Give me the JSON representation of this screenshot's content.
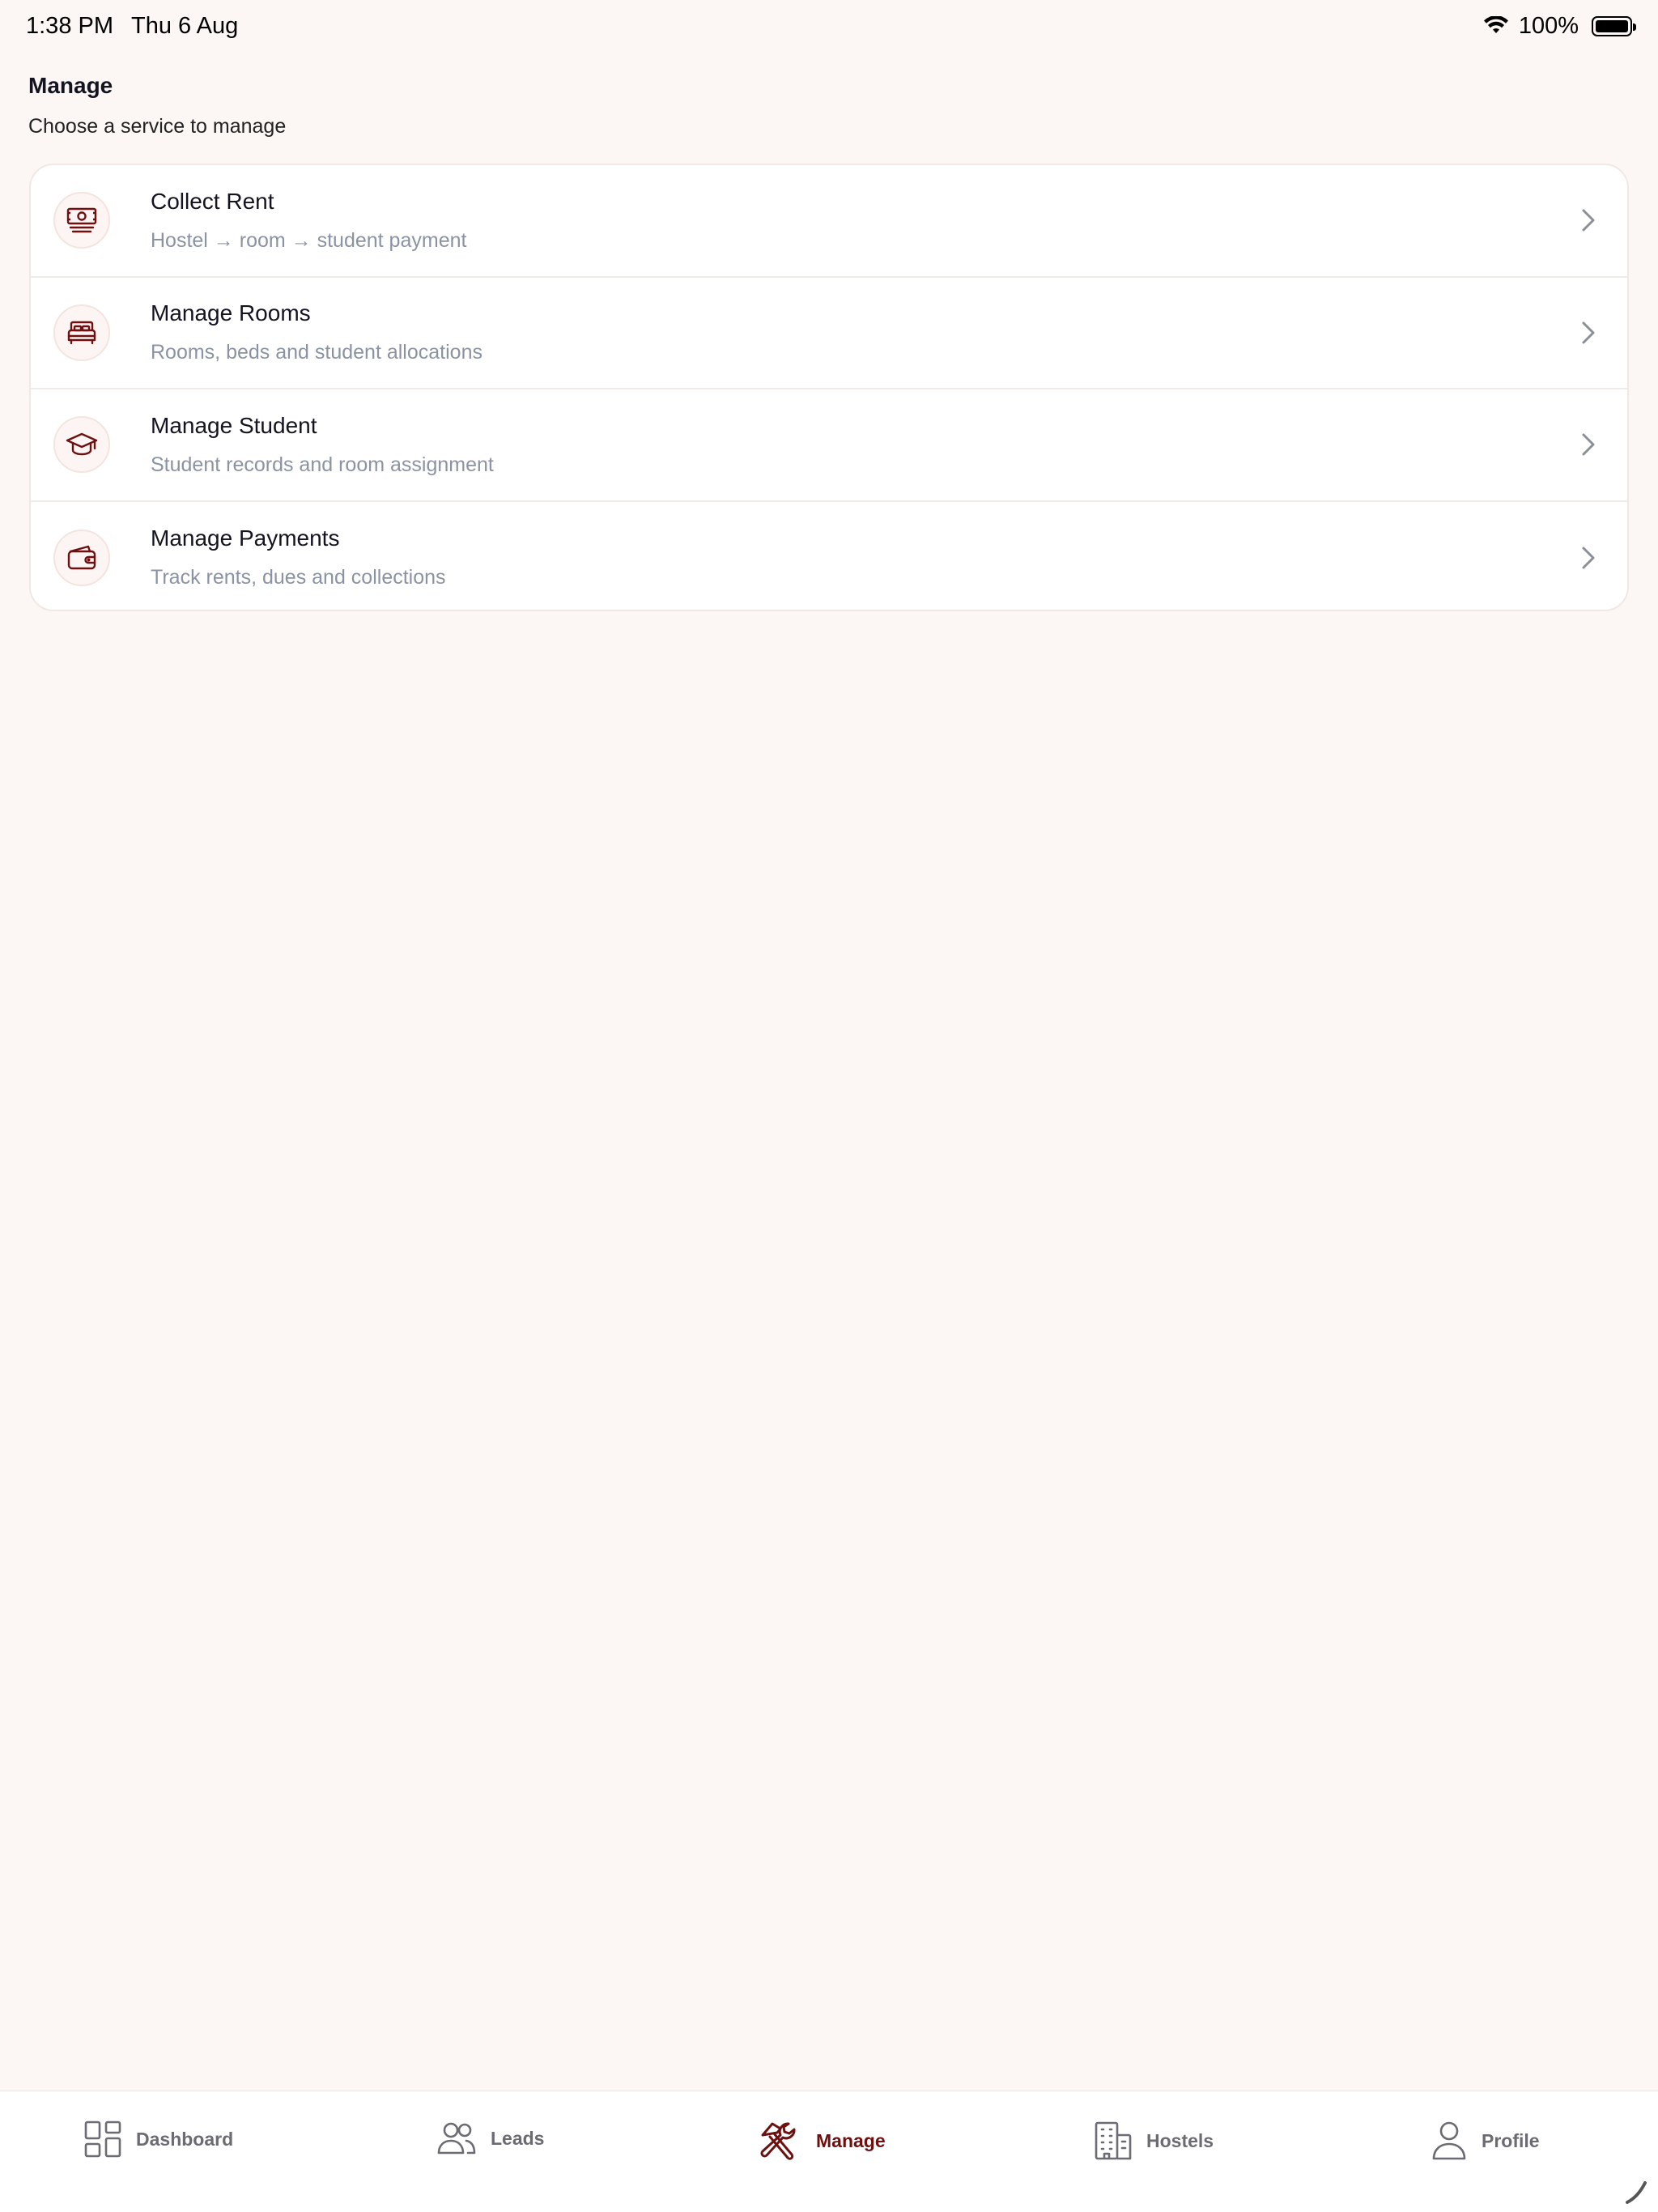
{
  "status_bar": {
    "time": "1:38 PM",
    "date": "Thu 6 Aug",
    "battery": "100%"
  },
  "header": {
    "title": "Manage",
    "subtitle": "Choose a service to manage"
  },
  "services": [
    {
      "title": "Collect Rent",
      "subtitle": "Hostel → room → student payment",
      "icon": "banknote-icon"
    },
    {
      "title": "Manage Rooms",
      "subtitle": "Rooms, beds and student allocations",
      "icon": "bed-icon"
    },
    {
      "title": "Manage Student",
      "subtitle": "Student records and room assignment",
      "icon": "graduation-cap-icon"
    },
    {
      "title": "Manage Payments",
      "subtitle": "Track rents, dues and collections",
      "icon": "wallet-icon"
    }
  ],
  "tabbar": {
    "dashboard": "Dashboard",
    "leads": "Leads",
    "manage": "Manage",
    "hostels": "Hostels",
    "profile": "Profile",
    "active": "Manage"
  },
  "colors": {
    "accent": "#6e1010",
    "background": "#fcf7f4",
    "muted_text": "#8b93a3"
  }
}
